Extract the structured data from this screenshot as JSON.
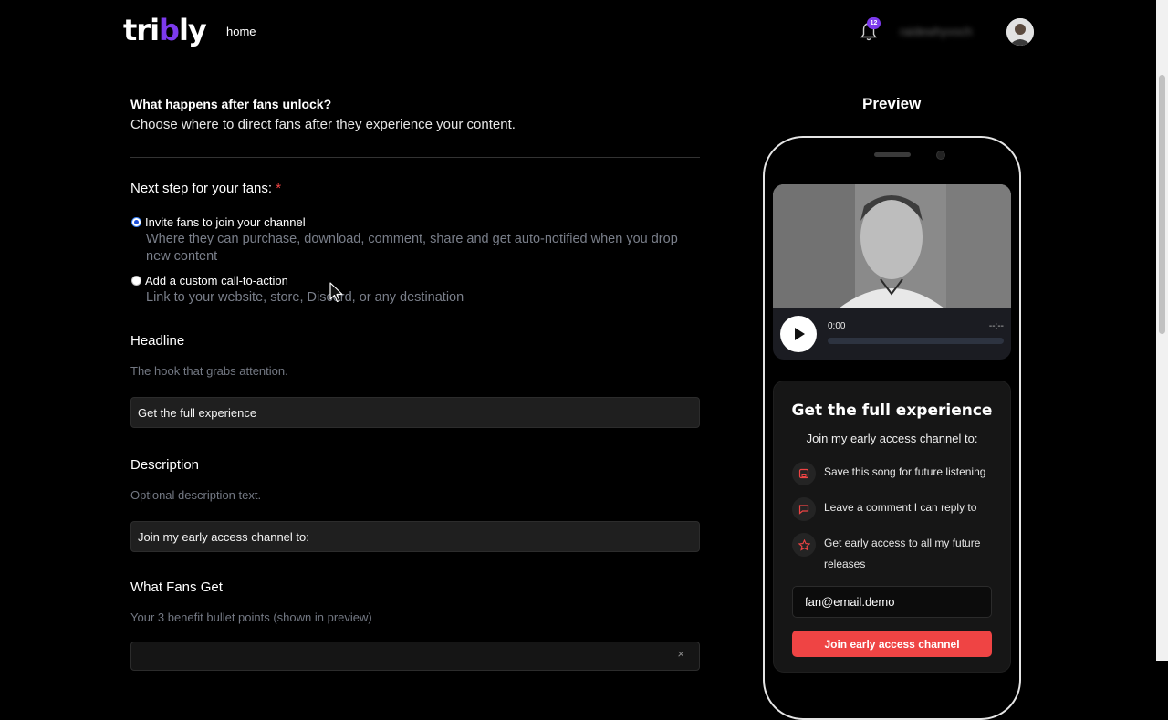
{
  "nav": {
    "logo_pre": "tri",
    "logo_b": "b",
    "logo_post": "ly",
    "home": "home",
    "notif_count": "12",
    "username": "raidewhyvoch"
  },
  "form": {
    "heading": "What happens after fans unlock?",
    "subheading": "Choose where to direct fans after they experience your content.",
    "next_step_label": "Next step for your fans:",
    "required_mark": "*",
    "options": [
      {
        "label": "Invite fans to join your channel",
        "desc": "Where they can purchase, download, comment, share and get auto-notified when you drop new content",
        "selected": true
      },
      {
        "label": "Add a custom call-to-action",
        "desc": "Link to your website, store, Discord, or any destination",
        "selected": false
      }
    ],
    "headline": {
      "title": "Headline",
      "hint": "The hook that grabs attention.",
      "value": "Get the full experience"
    },
    "description": {
      "title": "Description",
      "hint": "Optional description text.",
      "value": "Join my early access channel to:"
    },
    "benefits": {
      "title": "What Fans Get",
      "hint": "Your 3 benefit bullet points (shown in preview)",
      "close": "×"
    }
  },
  "preview": {
    "title": "Preview",
    "time_current": "0:00",
    "time_total": "--:--",
    "card_headline": "Get the full experience",
    "card_sub": "Join my early access channel to:",
    "benefits": [
      {
        "icon": "save-icon",
        "text": "Save this song for future listening"
      },
      {
        "icon": "comment-icon",
        "text": "Leave a comment I can reply to"
      },
      {
        "icon": "star-icon",
        "text": "Get early access to all my future releases"
      }
    ],
    "email_value": "fan@email.demo",
    "cta": "Join early access channel"
  },
  "colors": {
    "accent": "#7c3aed",
    "cta": "#ef4444",
    "background": "#000000"
  }
}
